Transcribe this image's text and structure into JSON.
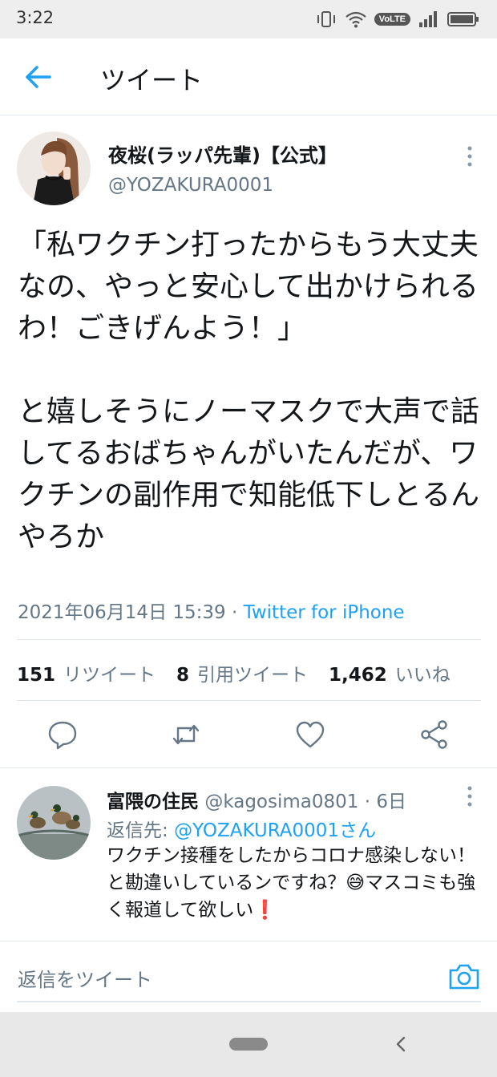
{
  "status_bar": {
    "time": "3:22",
    "network_label": "VoLTE"
  },
  "top_bar": {
    "title": "ツイート"
  },
  "tweet": {
    "author_name": "夜桜(ラッパ先輩)【公式】",
    "author_handle": "@YOZAKURA0001",
    "text": "「私ワクチン打ったからもう大丈夫なの、やっと安心して出かけられるわ！ごきげんよう！」\n\nと嬉しそうにノーマスクで大声で話してるおばちゃんがいたんだが、ワクチンの副作用で知能低下しとるんやろか",
    "timestamp": "2021年06月14日 15:39",
    "separator": " · ",
    "source": "Twitter for iPhone",
    "stats": {
      "retweets": "151",
      "retweets_label": "リツイート",
      "quotes": "8",
      "quotes_label": "引用ツイート",
      "likes": "1,462",
      "likes_label": "いいね"
    }
  },
  "reply": {
    "name": "富隈の住民",
    "handle": "@kagosima0801",
    "time": " · 6日",
    "reply_to_prefix": "返信先: ",
    "reply_to_mention": "@YOZAKURA0001さん",
    "text": "ワクチン接種をしたからコロナ感染しない！と勘違いしているンですね？😅マスコミも強く報道して欲しい❗"
  },
  "composer": {
    "placeholder": "返信をツイート"
  },
  "colors": {
    "accent": "#1da1f2",
    "secondary_text": "#657786",
    "divider": "#e1e8ed"
  }
}
